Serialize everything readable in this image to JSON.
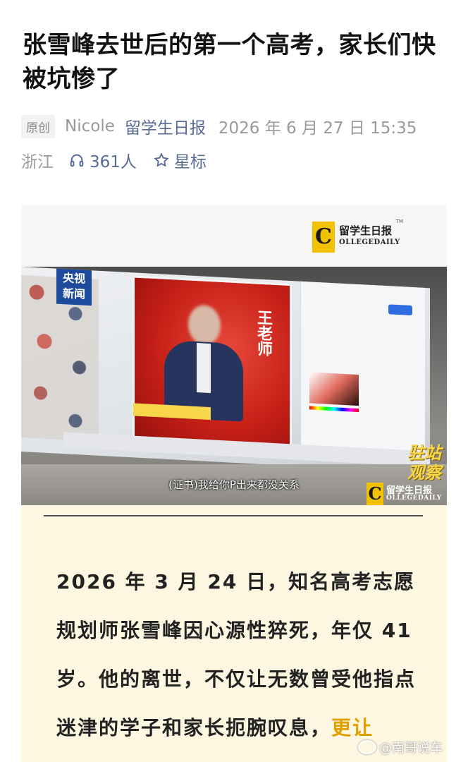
{
  "article": {
    "title": "张雪峰去世后的第一个高考，家长们快被坑惨了",
    "meta": {
      "original_badge": "原创",
      "author": "Nicole",
      "account": "留学生日报",
      "datetime": "2026 年 6 月 27 日 15:35",
      "region": "浙江",
      "listen_count": "361人",
      "star_label": "星标"
    },
    "image": {
      "logo_cn": "留学生日报",
      "logo_en": "OLLEGEDAILY",
      "logo_letter": "C",
      "logo_tm": "TM",
      "cctv_line1": "央视",
      "cctv_line2": "新闻",
      "poster_name": "王老师",
      "subtitle": "(证书)我给你P出来都没关系",
      "corner_tag_line1": "驻站",
      "corner_tag_line2": "观察"
    },
    "paragraph_main": "2026 年 3 月 24 日，知名高考志愿规划师张雪峰因心源性猝死，年仅 41 岁。他的离世，不仅让无数曾受他指点迷津的学子和家长扼腕叹息，",
    "paragraph_highlight": "更让"
  },
  "watermark": "@南哥说车",
  "colors": {
    "link": "#576b95",
    "highlight": "#e0a100",
    "article_bg": "#fdf6e0"
  }
}
